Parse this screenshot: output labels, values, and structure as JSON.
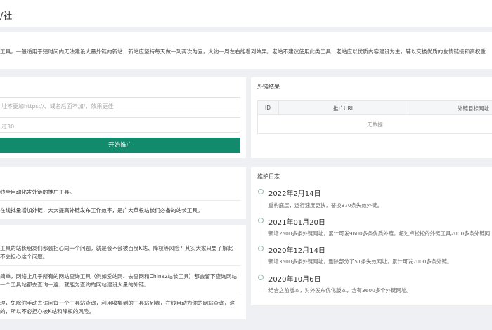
{
  "header": {
    "title": "/社"
  },
  "notice": {
    "text": "工具，一般适用于短时间内无法建设大量外链的新站，新站应坚持每天做一到两次为宜，大约一周左右能看到效果。老站不建议使用此类工具，老站应以优质内容建设为主，辅以交换优质的友情链接和高权重"
  },
  "form": {
    "url_placeholder": "址不要加https://、域名后面不加/，效果更佳",
    "count_placeholder": "过30",
    "submit_label": "开始推广"
  },
  "results": {
    "title": "外链结果",
    "columns": [
      "ID",
      "推广URL",
      "外链目标网址"
    ],
    "empty_text": "无数据"
  },
  "features": [
    "线全自动化发外链的推广工具。",
    "在线批量增加外链，大大提高外链发布工作效率，是广大草根站长们必备的站长工具。"
  ],
  "faq": [
    "工具的站长朋友们都会担心同一个问题，就是会不会被百度K站、降权等风险？其实大家只要了解此",
    "不会担心这个问题。",
    "简单，网络上几乎所有的网站查询工具（例如爱站网、去查网和Chinaz站长工具）都会留下查询网站",
    "一个工具站都去查询一遍，就能为查询的网站建设大量的外链。",
    "理，免除你手动去访问每一个工具站查询，利用收集到的工具站列表，在线自动为你的网站查询，这",
    "的，所以不必担心被K站和降权的风险。"
  ],
  "changelog": {
    "title": "维护日志",
    "entries": [
      {
        "date": "2022年2月14日",
        "desc": "重构底层，运行速度更快，替换370条失效外链。"
      },
      {
        "date": "2021年01月20日",
        "desc": "新增2500多条外链网址，累计可发9600多条优质外链，超过卢松松的外链工具2000多条外链网"
      },
      {
        "date": "2020年12月14日",
        "desc": "新增3500多条外链网址，删除部分了51条失效网址，累计可发7000多条外链。"
      },
      {
        "date": "2020年10月6日",
        "desc": "结合之前版本，对外发布优化版本，含有3600多个外链网址。"
      }
    ]
  },
  "colors": {
    "accent": "#128a6c",
    "background": "#eef0f3"
  }
}
